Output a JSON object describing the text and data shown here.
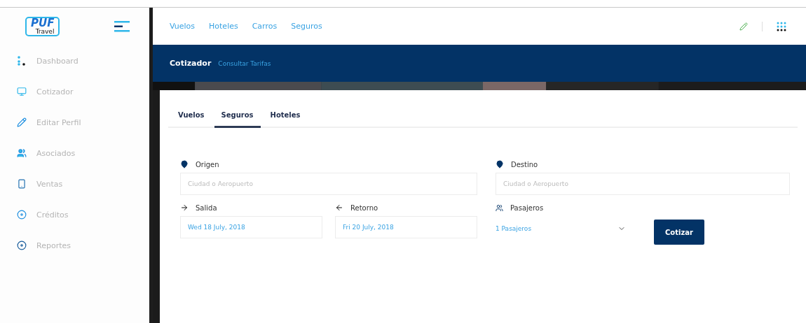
{
  "logo": {
    "mark": "PUF",
    "word": "Travel"
  },
  "nav": {
    "links": [
      "Vuelos",
      "Hoteles",
      "Carros",
      "Seguros"
    ]
  },
  "sidebar": {
    "items": [
      {
        "label": "Dashboard"
      },
      {
        "label": "Cotizador"
      },
      {
        "label": "Editar Perfil"
      },
      {
        "label": "Asociados"
      },
      {
        "label": "Ventas"
      },
      {
        "label": "Créditos"
      },
      {
        "label": "Reportes"
      }
    ]
  },
  "header": {
    "title": "Cotizador",
    "link": "Consultar Tarifas"
  },
  "tabs": [
    {
      "label": "Vuelos",
      "selected": false
    },
    {
      "label": "Seguros",
      "selected": true
    },
    {
      "label": "Hoteles",
      "selected": false
    }
  ],
  "form": {
    "origin": {
      "label": "Origen",
      "placeholder": "Ciudad o Aeropuerto"
    },
    "destination": {
      "label": "Destino",
      "placeholder": "Ciudad o Aeropuerto"
    },
    "departure": {
      "label": "Salida",
      "value": "Wed 18 July, 2018"
    },
    "return": {
      "label": "Retorno",
      "value": "Fri 20 July, 2018"
    },
    "passengers": {
      "label": "Pasajeros",
      "value": "1 Pasajeros"
    },
    "submit": "Cotizar"
  }
}
